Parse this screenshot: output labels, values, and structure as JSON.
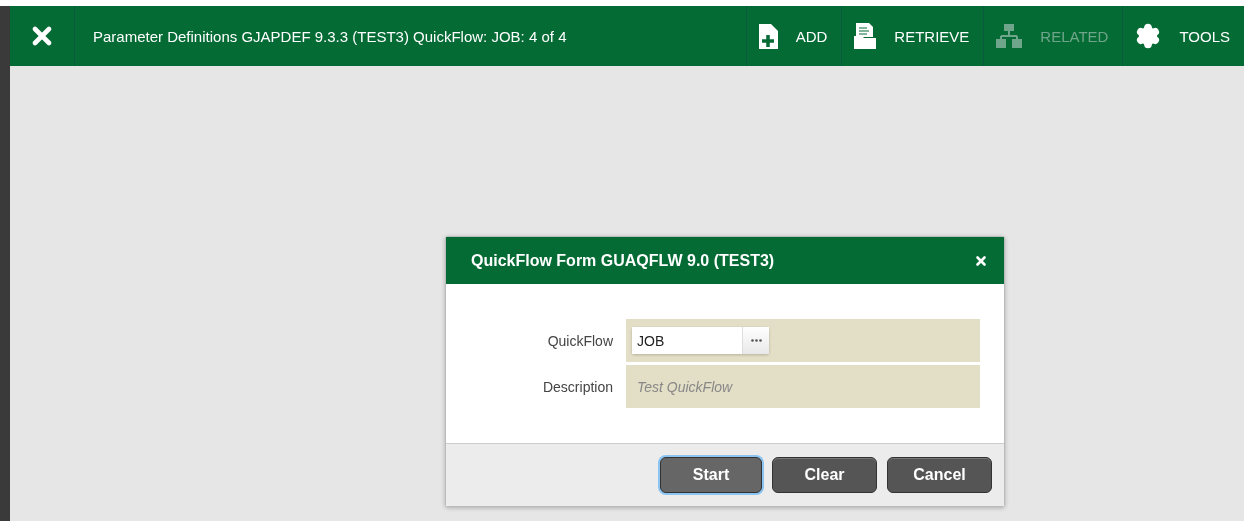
{
  "header": {
    "title": "Parameter Definitions GJAPDEF 9.3.3 (TEST3) QuickFlow: JOB: 4 of 4",
    "actions": [
      {
        "kind": "add",
        "label": "ADD",
        "disabled": false
      },
      {
        "kind": "retrieve",
        "label": "RETRIEVE",
        "disabled": false
      },
      {
        "kind": "related",
        "label": "RELATED",
        "disabled": true
      },
      {
        "kind": "tools",
        "label": "TOOLS",
        "disabled": false
      }
    ]
  },
  "dialog": {
    "title": "QuickFlow Form GUAQFLW 9.0 (TEST3)",
    "fields": [
      {
        "kind": "lookup",
        "label": "QuickFlow",
        "value": "JOB"
      },
      {
        "kind": "readonly",
        "label": "Description",
        "value": "Test QuickFlow"
      }
    ],
    "buttons": [
      {
        "label": "Start",
        "focused": true
      },
      {
        "label": "Clear",
        "focused": false
      },
      {
        "label": "Cancel",
        "focused": false
      }
    ]
  }
}
